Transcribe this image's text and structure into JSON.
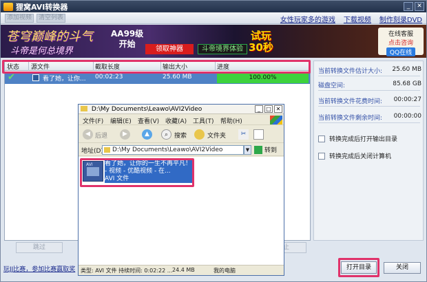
{
  "app": {
    "title": "狸窝AVI转换器",
    "toolbar_buttons": [
      "添加视频",
      "清空列表"
    ],
    "top_links": [
      "女性玩家多的游戏",
      "下载视频",
      "制作刻录DVD"
    ]
  },
  "banner": {
    "line1": "苍穹巅峰的斗气",
    "line2": "斗帝是何总境界",
    "promo": [
      "AA99级",
      "开始"
    ],
    "button1": "领取神器",
    "button2": "斗帝境界体验",
    "trial": [
      "试玩",
      "30秒"
    ],
    "ad_box": [
      "在线客服",
      "点击咨询",
      "QQ在线"
    ]
  },
  "table": {
    "headers": [
      "状态",
      "源文件",
      "截取长度",
      "输出大小",
      "进度"
    ],
    "rows": [
      {
        "file": "看了她，让你...",
        "duration": "00:02:23",
        "size": "25.60 MB",
        "progress": "100.00%"
      }
    ]
  },
  "bottom_buttons": [
    "跳过",
    "停止"
  ],
  "right_panel": {
    "stats": [
      {
        "label": "当前转换文件估计大小:",
        "value": "25.60 MB"
      },
      {
        "label": "磁盘空间:",
        "value": "85.68 GB"
      },
      {
        "label": "当前转换文件花费时间:",
        "value": "00:00:27"
      },
      {
        "label": "当前转换文件剩余时间:",
        "value": "00:00:00"
      }
    ],
    "options": [
      "转换完成后打开输出目录",
      "转换完成后关闭计算机"
    ]
  },
  "footer": {
    "link": "玩JJ比赛，参加比赛赢取奖",
    "open_label": "打开目录",
    "close_label": "关闭"
  },
  "explorer": {
    "title": "D:\\My Documents\\Leawo\\AVI2Video",
    "menu": [
      "文件(F)",
      "编辑(E)",
      "查看(V)",
      "收藏(A)",
      "工具(T)",
      "帮助(H)"
    ],
    "back_label": "后退",
    "search_label": "搜索",
    "folders_label": "文件夹",
    "address_label": "地址(D)",
    "address_value": "D:\\My Documents\\Leawo\\AVI2Video",
    "go_label": "转到",
    "file_name": "看了她，让你的一生不再平凡！ - 视频 - 优酷视频 - 在...",
    "file_type": "AVI 文件",
    "thumb_label": "AVI",
    "status_type": "类型: AVI 文件 持续时间: 0:02:22 ...",
    "status_size": "24.4 MB",
    "status_location": "我的电脑"
  }
}
